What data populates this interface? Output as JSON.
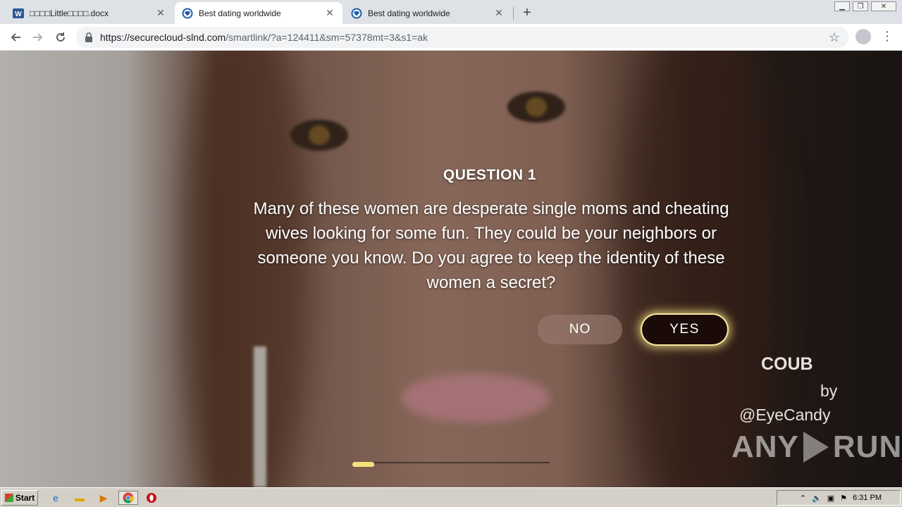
{
  "browser": {
    "tabs": [
      {
        "title": "□□□□Little□□□□.docx",
        "favicon": "word-icon",
        "active": false
      },
      {
        "title": "Best dating worldwide",
        "favicon": "heart-shield-icon",
        "active": true
      },
      {
        "title": "Best dating worldwide",
        "favicon": "heart-shield-icon",
        "active": false
      }
    ],
    "url_host": "https://securecloud-slnd.com",
    "url_path": "/smartlink/?a=124411&sm=57378mt=3&s1=ak"
  },
  "quiz": {
    "title": "QUESTION 1",
    "text": "Many of these women are desperate single moms and cheating wives looking for some fun. They could be your neighbors or someone you know. Do you agree to keep the identity of these women a secret?",
    "no_label": "NO",
    "yes_label": "YES",
    "progress_fraction": 0.11
  },
  "overlay": {
    "brand": "COUB",
    "by": "by",
    "user": "@EyeCandy",
    "watermark_left": "ANY",
    "watermark_right": "RUN"
  },
  "taskbar": {
    "start_label": "Start",
    "clock": "6:31 PM"
  },
  "colors": {
    "yes_button": "#1a0a08",
    "yes_glow": "#f6e89a",
    "progress": "#f5e27a"
  }
}
